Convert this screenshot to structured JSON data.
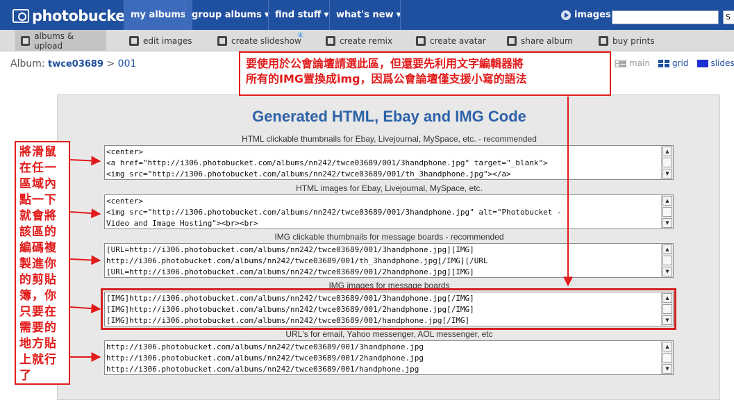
{
  "logo": "photobucket",
  "nav": {
    "tabs": [
      "my albums",
      "group albums",
      "find stuff",
      "what's new"
    ],
    "images_label": "images",
    "search_value": "",
    "search_btn": "S"
  },
  "subnav": [
    "albums & upload",
    "edit images",
    "create slideshow",
    "create remix",
    "create avatar",
    "share album",
    "buy prints"
  ],
  "album": {
    "label": "Album:",
    "user": "twce03689",
    "sep": " > ",
    "folder": "001"
  },
  "views": [
    "main",
    "grid",
    "slidesh"
  ],
  "panel": {
    "title": "Generated HTML, Ebay and IMG Code",
    "sections": [
      {
        "label": "HTML clickable thumbnails for Ebay, Livejournal, MySpace, etc. - recommended",
        "lines": [
          "<center>",
          "<a href=\"http://i306.photobucket.com/albums/nn242/twce03689/001/3handphone.jpg\" target=\"_blank\">",
          "<img src=\"http://i306.photobucket.com/albums/nn242/twce03689/001/th_3handphone.jpg\"></a>"
        ]
      },
      {
        "label": "HTML images for Ebay, Livejournal, MySpace, etc.",
        "lines": [
          "<center>",
          "<img src=\"http://i306.photobucket.com/albums/nn242/twce03689/001/3handphone.jpg\" alt=\"Photobucket -",
          "Video and Image Hosting\"><br><br>"
        ]
      },
      {
        "label": "IMG clickable thumbnails for message boards - recommended",
        "lines": [
          "[URL=http://i306.photobucket.com/albums/nn242/twce03689/001/3handphone.jpg][IMG]",
          "http://i306.photobucket.com/albums/nn242/twce03689/001/th_3handphone.jpg[/IMG][/URL",
          "[URL=http://i306.photobucket.com/albums/nn242/twce03689/001/2handphone.jpg][IMG]"
        ]
      },
      {
        "label": "IMG images for message boards",
        "lines": [
          "[IMG]http://i306.photobucket.com/albums/nn242/twce03689/001/3handphone.jpg[/IMG]",
          "[IMG]http://i306.photobucket.com/albums/nn242/twce03689/001/2handphone.jpg[/IMG]",
          "[IMG]http://i306.photobucket.com/albums/nn242/twce03689/001/handphone.jpg[/IMG]"
        ]
      },
      {
        "label": "URL's for email, Yahoo messenger, AOL messenger, etc",
        "lines": [
          "http://i306.photobucket.com/albums/nn242/twce03689/001/3handphone.jpg",
          "http://i306.photobucket.com/albums/nn242/twce03689/001/2handphone.jpg",
          "http://i306.photobucket.com/albums/nn242/twce03689/001/handphone.jpg"
        ]
      }
    ]
  },
  "annotations": {
    "top_line1": "要使用於公會論壇請選此區，但還要先利用文字編輯器將",
    "top_line2": "所有的IMG置換成img，因爲公會論壇僅支援小寫的語法",
    "left": "將滑鼠在任一區域內點一下就會將該區的編碼複製進你的剪貼簿，你只要在需要的地方貼上就行了"
  },
  "colors": {
    "nav_bg": "#1f4f9f",
    "title": "#2d62a8",
    "annotation": "#e21b1b"
  }
}
